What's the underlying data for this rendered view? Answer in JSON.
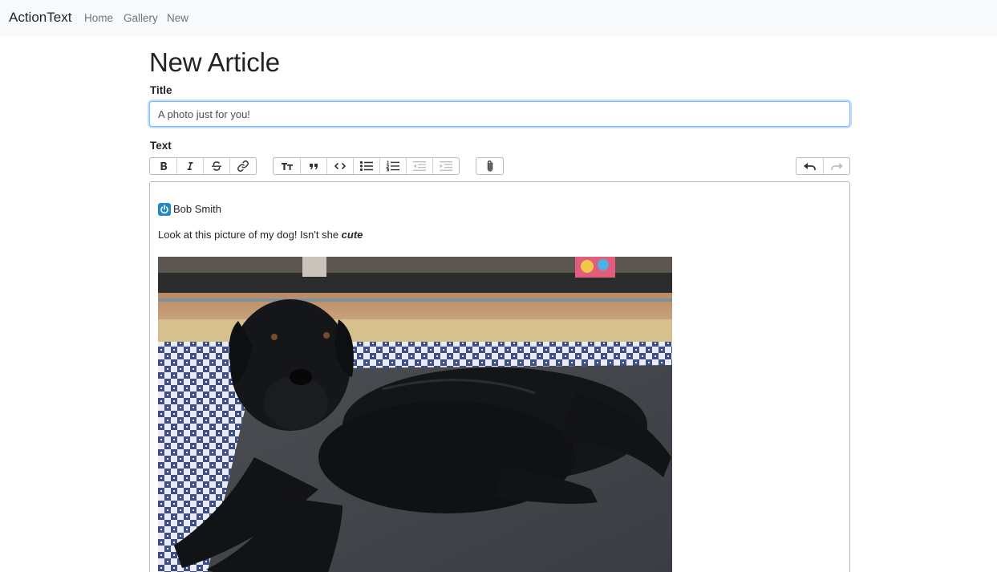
{
  "navbar": {
    "brand": "ActionText",
    "links": [
      "Home",
      "Gallery",
      "New"
    ]
  },
  "form": {
    "heading": "New Article",
    "title_label": "Title",
    "title_value": "A photo just for you!",
    "text_label": "Text"
  },
  "toolbar": {
    "text_tools": [
      "bold-icon",
      "italic-icon",
      "strikethrough-icon",
      "link-icon"
    ],
    "block_tools": [
      "heading-icon",
      "quote-icon",
      "code-icon",
      "bullet-list-icon",
      "number-list-icon",
      "decrease-indent-icon",
      "increase-indent-icon"
    ],
    "file_tools": [
      "paperclip-icon"
    ],
    "history_tools": [
      "undo-icon",
      "redo-icon"
    ]
  },
  "editor": {
    "mention_name": "Bob Smith",
    "body_text": "Look at this picture of my dog! Isn't she ",
    "body_emphasis": "cute",
    "image_alt": "black labrador lying on a grey yoga mat over a blue and white checkered rug"
  },
  "colors": {
    "navbar_bg": "#f8f9fa",
    "focus_border": "#80bdff",
    "mention_avatar": "#1f8ac6"
  }
}
